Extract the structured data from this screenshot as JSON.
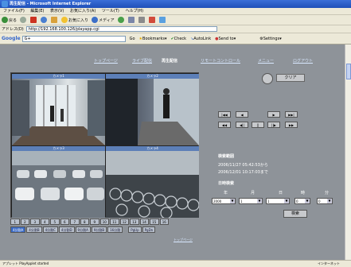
{
  "window": {
    "title": "再生配信 - Microsoft Internet Explorer"
  },
  "menu": [
    "ファイル(F)",
    "編集(E)",
    "表示(V)",
    "お気に入り(A)",
    "ツール(T)",
    "ヘルプ(H)"
  ],
  "toolbar": {
    "back": "戻る",
    "favorites": "お気に入り",
    "media": "メディア"
  },
  "address": {
    "label": "アドレス(D)",
    "url": "http://192.168.100.126/playapp.cgi"
  },
  "google": {
    "logo": "Google",
    "query": "G+",
    "go": "Go",
    "bookmarks": "Bookmarks▾",
    "check": "Check",
    "autolink": "AutoLink",
    "sendto": "Send to▾",
    "settings": "Settings▾"
  },
  "nav": {
    "items": [
      "トップページ",
      "ライブ配信",
      "再生配信",
      "リモートコントロール",
      "メニュー",
      "ログアウト"
    ],
    "active": 2
  },
  "clear_label": "クリア",
  "cameras": [
    {
      "label": "カメラ1",
      "scene": "lobby"
    },
    {
      "label": "カメラ2",
      "scene": "corridor"
    },
    {
      "label": "カメラ3",
      "scene": "parking"
    },
    {
      "label": "カメラ4",
      "scene": "bicycles"
    }
  ],
  "channels": [
    "1",
    "2",
    "3",
    "4",
    "5",
    "6",
    "7",
    "8",
    "9",
    "10",
    "11",
    "12",
    "13",
    "14",
    "15",
    "16"
  ],
  "splits": [
    "4分割A",
    "4分割B",
    "4分割C",
    "4分割D",
    "9分割A",
    "9分割B",
    "16分割"
  ],
  "split_active": 0,
  "page_buttons": [
    "PgUp",
    "PgDn"
  ],
  "top_link": "トップページ",
  "controls": {
    "row1": [
      "|◀◀",
      "◀",
      "▶",
      "▶▶|"
    ],
    "row2": [
      "◀◀",
      "◀||",
      "||",
      "||▶",
      "▶▶"
    ]
  },
  "search": {
    "range_label": "検索範囲",
    "range_from": "2006/11/27 05:42:53から",
    "range_to": "2006/12/01 10:17:03まで",
    "date_label": "日時検索",
    "year_label": "年",
    "month_label": "月",
    "day_label": "日",
    "hour_label": "時",
    "minute_label": "分",
    "year": "2000",
    "month": "1",
    "day": "1",
    "hour": "0",
    "minute": "0",
    "button": "検索"
  },
  "status": {
    "text": "アプレット PlayApplet started",
    "zone": "インターネット"
  }
}
